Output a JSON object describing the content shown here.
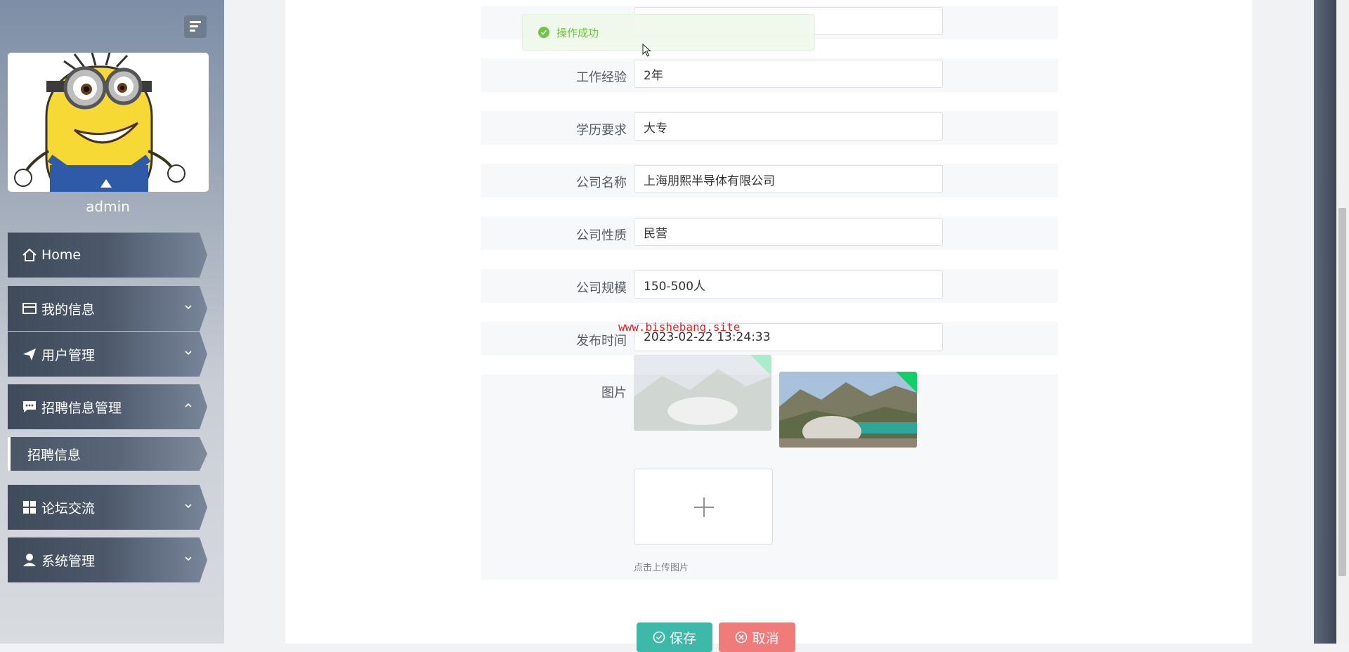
{
  "sidebar": {
    "username": "admin",
    "menu": [
      {
        "label": "Home",
        "icon": "home-icon"
      },
      {
        "label": "我的信息",
        "icon": "card-icon",
        "expandable": true
      },
      {
        "label": "用户管理",
        "icon": "paper-plane-icon",
        "expandable": true
      },
      {
        "label": "招聘信息管理",
        "icon": "chat-icon",
        "expandable": true,
        "expanded": true
      },
      {
        "label": "论坛交流",
        "icon": "grid-icon",
        "expandable": true
      },
      {
        "label": "系统管理",
        "icon": "user-icon",
        "expandable": true
      }
    ],
    "submenu": [
      {
        "label": "招聘信息",
        "active": true
      }
    ]
  },
  "toast": {
    "text": "操作成功"
  },
  "form": {
    "fields": [
      {
        "label": "",
        "value": ""
      },
      {
        "label": "工作经验",
        "value": "2年"
      },
      {
        "label": "学历要求",
        "value": "大专"
      },
      {
        "label": "公司名称",
        "value": "上海朋熙半导体有限公司"
      },
      {
        "label": "公司性质",
        "value": "民营"
      },
      {
        "label": "公司规模",
        "value": "150-500人"
      },
      {
        "label": "发布时间",
        "value": "2023-02-22 13:24:33"
      }
    ],
    "image_label": "图片",
    "upload_hint": "点击上传图片",
    "save_label": "保存",
    "cancel_label": "取消"
  },
  "watermark": "www.bishebang.site",
  "colors": {
    "save": "#3eb8a8",
    "cancel": "#f07b7b",
    "success": "#67c23a",
    "sidebar_dark": "#3f4a5a"
  }
}
